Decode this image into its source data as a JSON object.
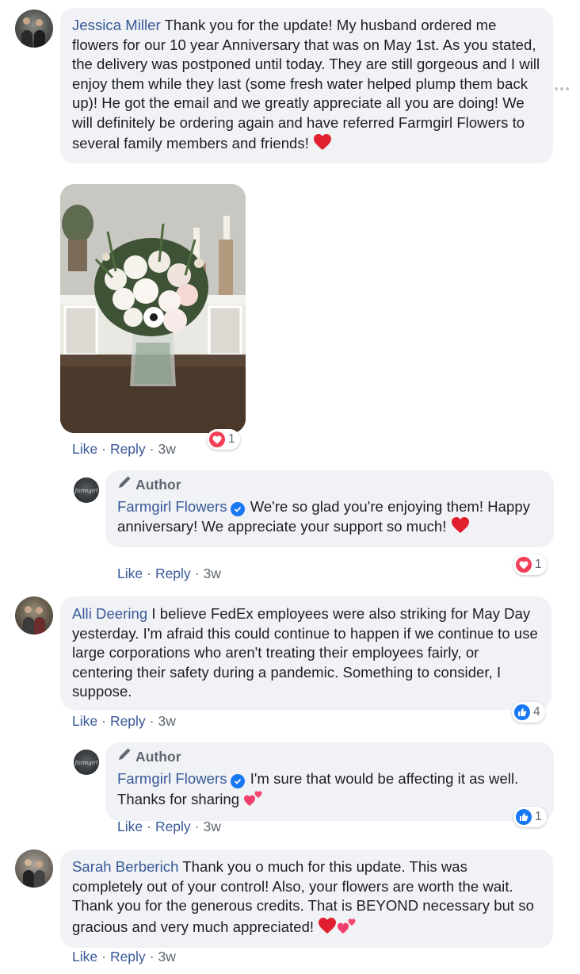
{
  "comments": [
    {
      "name": "Jessica Miller",
      "text": "Thank you for the update! My husband ordered me flowers for our 10 year Anniversary that was on May 1st. As you stated, the delivery was postponed until today. They are still gorgeous and I will enjoy them while they last (some fresh water helped plump them back up)! He got the email and we greatly appreciate all you are doing! We will definitely be ordering again and have referred Farmgirl Flowers to several family members and friends!",
      "emoji": "red-heart",
      "actions": {
        "like": "Like",
        "reply": "Reply",
        "time": "3w"
      },
      "reaction": {
        "type": "love",
        "count": "1"
      },
      "reply": {
        "author_label": "Author",
        "name": "Farmgirl Flowers",
        "text": "We're so glad you're enjoying them! Happy anniversary! We appreciate your support so much!",
        "emoji": "red-heart",
        "actions": {
          "like": "Like",
          "reply": "Reply",
          "time": "3w"
        },
        "reaction": {
          "type": "love",
          "count": "1"
        }
      }
    },
    {
      "name": "Alli Deering",
      "text": "I believe FedEx employees were also striking for May Day yesterday. I'm afraid this could continue to happen if we continue to use large corporations who aren't treating their employees fairly, or centering their safety during a pandemic. Something to consider, I suppose.",
      "actions": {
        "like": "Like",
        "reply": "Reply",
        "time": "3w"
      },
      "reaction": {
        "type": "like",
        "count": "4"
      },
      "reply": {
        "author_label": "Author",
        "name": "Farmgirl Flowers",
        "text": "I'm sure that would be affecting it as well. Thanks for sharing",
        "emoji": "two-hearts",
        "actions": {
          "like": "Like",
          "reply": "Reply",
          "time": "3w"
        },
        "reaction": {
          "type": "like",
          "count": "1"
        }
      }
    },
    {
      "name": "Sarah Berberich",
      "text": "Thank you o much for this update. This was completely out of your control! Also, your flowers are worth the wait. Thank you for the generous credits. That is BEYOND necessary but so gracious and very much appreciated!",
      "emoji": "red-heart two-hearts",
      "actions": {
        "like": "Like",
        "reply": "Reply",
        "time": "3w"
      }
    }
  ],
  "colors": {
    "link": "#385898",
    "bubble": "#f0f2f5",
    "love": "#f33e58",
    "like": "#1877f2"
  }
}
